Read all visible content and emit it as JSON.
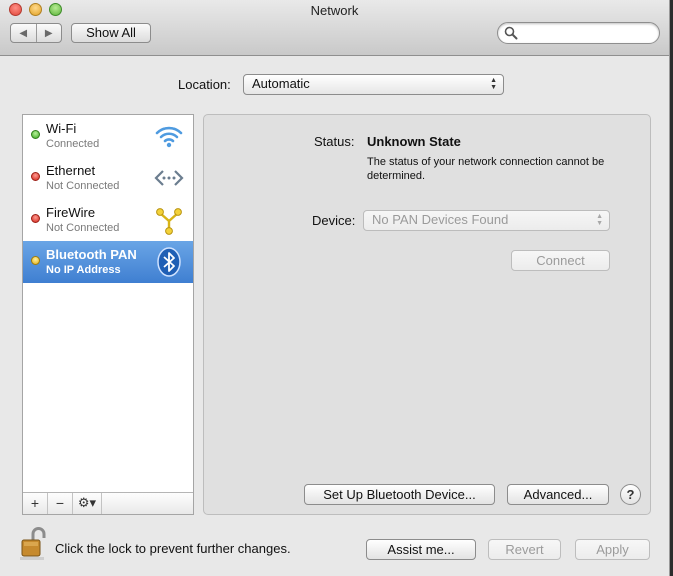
{
  "window": {
    "title": "Network"
  },
  "toolbar": {
    "back_icon": "triangle-left",
    "forward_icon": "triangle-right",
    "show_all_label": "Show All",
    "search_placeholder": ""
  },
  "location": {
    "label": "Location:",
    "value": "Automatic"
  },
  "services": [
    {
      "name": "Wi-Fi",
      "status": "Connected",
      "status_color": "#3aa81f",
      "icon": "wifi-icon",
      "selected": false
    },
    {
      "name": "Ethernet",
      "status": "Not Connected",
      "status_color": "#d2261a",
      "icon": "ethernet-icon",
      "selected": false
    },
    {
      "name": "FireWire",
      "status": "Not Connected",
      "status_color": "#d2261a",
      "icon": "firewire-icon",
      "selected": false
    },
    {
      "name": "Bluetooth PAN",
      "status": "No IP Address",
      "status_color": "#e3b013",
      "icon": "bluetooth-icon",
      "selected": true
    }
  ],
  "sidebar_controls": {
    "add": "+",
    "remove": "−",
    "gear_icon": "gear-icon"
  },
  "detail": {
    "status_label": "Status:",
    "status_value": "Unknown State",
    "status_description": "The status of your network connection cannot be determined.",
    "device_label": "Device:",
    "device_value": "No PAN Devices Found",
    "connect_label": "Connect",
    "setup_label": "Set Up Bluetooth Device...",
    "advanced_label": "Advanced...",
    "help_label": "?"
  },
  "footer": {
    "lock_text": "Click the lock to prevent further changes.",
    "assist_label": "Assist me...",
    "revert_label": "Revert",
    "apply_label": "Apply"
  },
  "colors": {
    "selection": "#3f7fd1",
    "window_bg": "#e8e8e8"
  }
}
